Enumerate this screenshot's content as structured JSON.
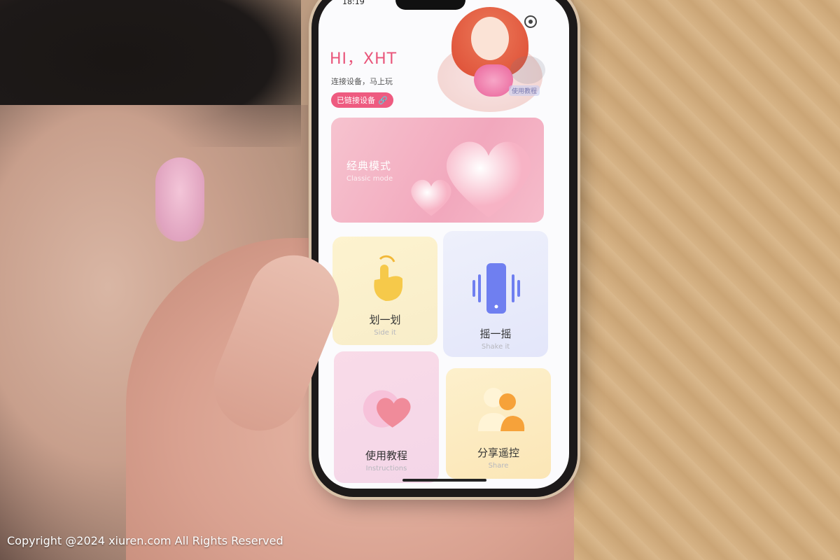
{
  "status": {
    "time": "18:19"
  },
  "header": {
    "greeting": "HI，XHT",
    "subtitle": "连接设备，马上玩",
    "connected_label": "已链接设备",
    "badge_text": "使用教程"
  },
  "classic_mode": {
    "title": "经典模式",
    "subtitle": "Classic mode"
  },
  "tiles": [
    {
      "title": "划一划",
      "subtitle": "Side it",
      "icon": "tap-hand-icon"
    },
    {
      "title": "摇一摇",
      "subtitle": "Shake it",
      "icon": "phone-vibrate-icon"
    },
    {
      "title": "使用教程",
      "subtitle": "Instructions",
      "icon": "heart-bubble-icon"
    },
    {
      "title": "分享遥控",
      "subtitle": "Share",
      "icon": "users-share-icon"
    }
  ],
  "watermark": "Copyright @2024  xiuren.com  All Rights Reserved",
  "colors": {
    "accent": "#ee5b80",
    "greeting": "#e9557a",
    "shake_blue": "#6f7ff0",
    "swipe_yellow": "#f6c94a"
  }
}
